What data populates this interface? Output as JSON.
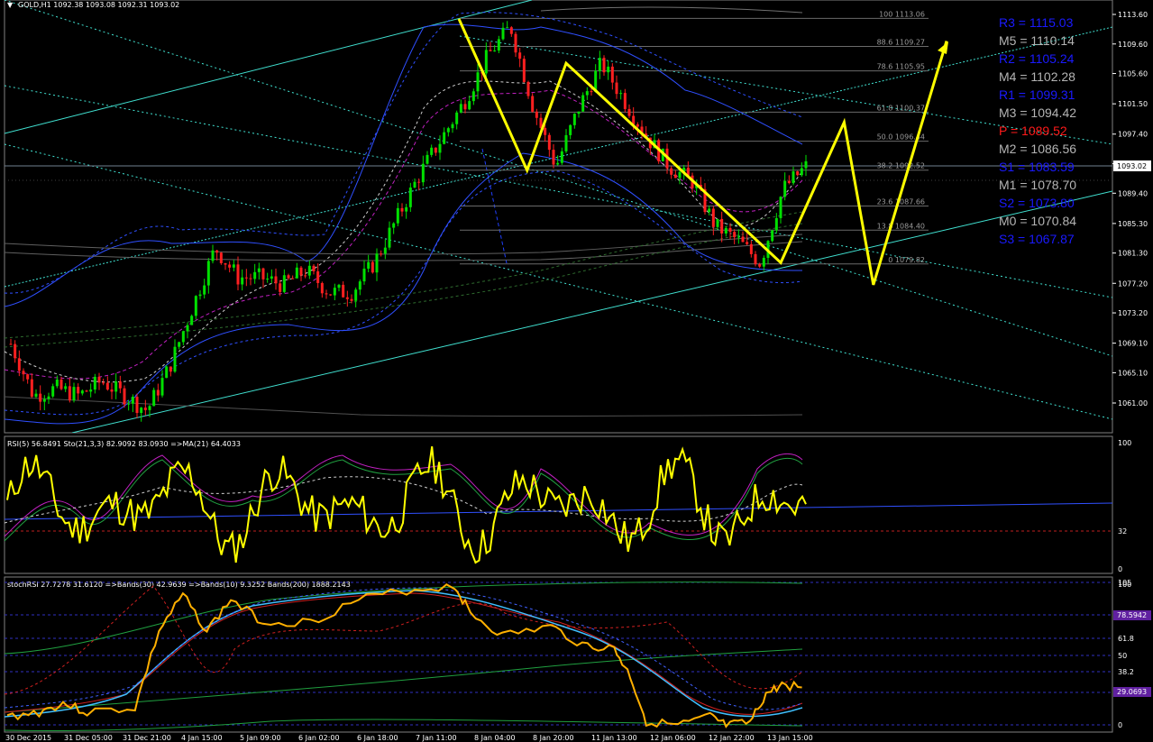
{
  "window": {
    "symbol_header": "GOLD,H1  1092.38 1093.08 1092.31 1093.02",
    "current_price": "1093.02"
  },
  "pivots": [
    {
      "text": "R3 = 1115.03",
      "color": "#1a1aff"
    },
    {
      "text": "M5 = 1110.14",
      "color": "#b4b4b4"
    },
    {
      "text": "R2 = 1105.24",
      "color": "#1a1aff"
    },
    {
      "text": "M4 = 1102.28",
      "color": "#b4b4b4"
    },
    {
      "text": "R1 = 1099.31",
      "color": "#1a1aff"
    },
    {
      "text": "M3 = 1094.42",
      "color": "#b4b4b4"
    },
    {
      "text": "P  = 1089.52",
      "color": "#ff1a1a"
    },
    {
      "text": "M2 = 1086.56",
      "color": "#b4b4b4"
    },
    {
      "text": "S1 = 1083.59",
      "color": "#1a1aff"
    },
    {
      "text": "M1 = 1078.70",
      "color": "#b4b4b4"
    },
    {
      "text": "S2 = 1073.80",
      "color": "#1a1aff"
    },
    {
      "text": "M0 = 1070.84",
      "color": "#b4b4b4"
    },
    {
      "text": "S3 = 1067.87",
      "color": "#1a1aff"
    }
  ],
  "fib_levels": [
    {
      "label": "100 1113.06",
      "price": 1113.06
    },
    {
      "label": "88.6 1109.27",
      "price": 1109.27
    },
    {
      "label": "78.6 1105.95",
      "price": 1105.95
    },
    {
      "label": "61.8 1100.37",
      "price": 1100.37
    },
    {
      "label": "50.0 1096.44",
      "price": 1096.44
    },
    {
      "label": "38.2 1092.52",
      "price": 1092.52
    },
    {
      "label": "23.6 1087.66",
      "price": 1087.66
    },
    {
      "label": "13.8 1084.40",
      "price": 1084.4
    },
    {
      "label": "0 1079.82",
      "price": 1079.82
    }
  ],
  "indicators": {
    "rsi_header": "RSI(5) 56.8491  Sto(21,3,3) 82.9092 83.0930  =>MA(21) 64.4033",
    "rsi_ticks": [
      "100",
      "32",
      "0"
    ],
    "stoch_header": "stochRSI 27.7278 31.6120  =>Bands(30) 42.9639  =>Bands(10) 9.3252  Bands(200) 1888.2143",
    "stoch_ticks": [
      "105",
      "100",
      "61.8",
      "50",
      "38.2",
      "0"
    ],
    "stoch_badges": [
      "78.5942",
      "29.0693"
    ]
  },
  "time_labels": [
    "30 Dec 2015",
    "31 Dec 05:00",
    "31 Dec 21:00",
    "4 Jan 15:00",
    "5 Jan 09:00",
    "6 Jan 02:00",
    "6 Jan 18:00",
    "7 Jan 11:00",
    "8 Jan 04:00",
    "8 Jan 20:00",
    "11 Jan 13:00",
    "12 Jan 06:00",
    "12 Jan 22:00",
    "13 Jan 15:00"
  ],
  "chart_data": {
    "type": "line",
    "title": "GOLD,H1",
    "ylim": [
      1057.6,
      1114.9
    ],
    "y_ticks": [
      1113.6,
      1109.6,
      1105.6,
      1101.5,
      1097.4,
      1093.4,
      1089.4,
      1085.3,
      1081.3,
      1077.2,
      1073.2,
      1069.1,
      1065.1,
      1061.0
    ],
    "close_approx": [
      1069,
      1062,
      1063,
      1062,
      1064,
      1062,
      1060,
      1066,
      1074,
      1082,
      1078,
      1078,
      1077,
      1079,
      1076,
      1076,
      1080,
      1086,
      1092,
      1097,
      1102,
      1108,
      1112,
      1101,
      1093,
      1101,
      1107,
      1102,
      1097,
      1093,
      1091,
      1085,
      1083,
      1080,
      1090,
      1093
    ],
    "series": [
      {
        "name": "ZigZag",
        "color": "#ffff00",
        "points": [
          [
            0.0,
            1113.0
          ],
          [
            0.14,
            1092.5
          ],
          [
            0.22,
            1107.0
          ],
          [
            0.66,
            1080.0
          ],
          [
            0.79,
            1099.0
          ],
          [
            0.85,
            1077.0
          ],
          [
            1.0,
            1110.0
          ]
        ]
      }
    ]
  }
}
